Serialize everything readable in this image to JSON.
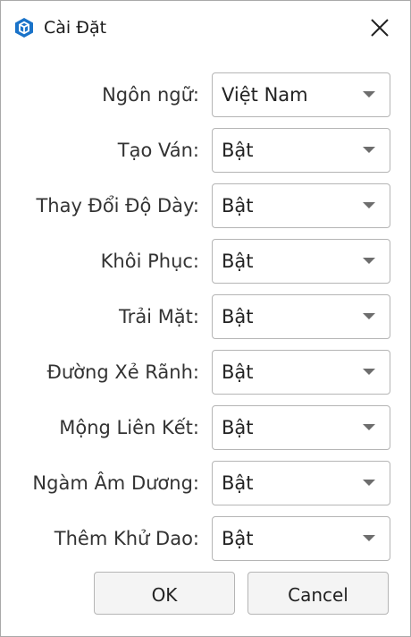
{
  "window": {
    "title": "Cài Đặt",
    "icon": "sketchup-logo-icon",
    "close_icon": "close-icon"
  },
  "settings": [
    {
      "label": "Ngôn ngữ:",
      "value": "Việt Nam"
    },
    {
      "label": "Tạo Ván:",
      "value": "Bật"
    },
    {
      "label": "Thay Đổi Độ Dày:",
      "value": "Bật"
    },
    {
      "label": "Khôi Phục:",
      "value": "Bật"
    },
    {
      "label": "Trải Mặt:",
      "value": "Bật"
    },
    {
      "label": "Đường Xẻ Rãnh:",
      "value": "Bật"
    },
    {
      "label": "Mộng Liên Kết:",
      "value": "Bật"
    },
    {
      "label": "Ngàm Âm Dương:",
      "value": "Bật"
    },
    {
      "label": "Thêm Khử Dao:",
      "value": "Bật"
    }
  ],
  "buttons": {
    "ok": "OK",
    "cancel": "Cancel"
  },
  "colors": {
    "icon_blue": "#1a73c9",
    "border": "#b5b5b5",
    "button_bg": "#f4f4f4"
  }
}
